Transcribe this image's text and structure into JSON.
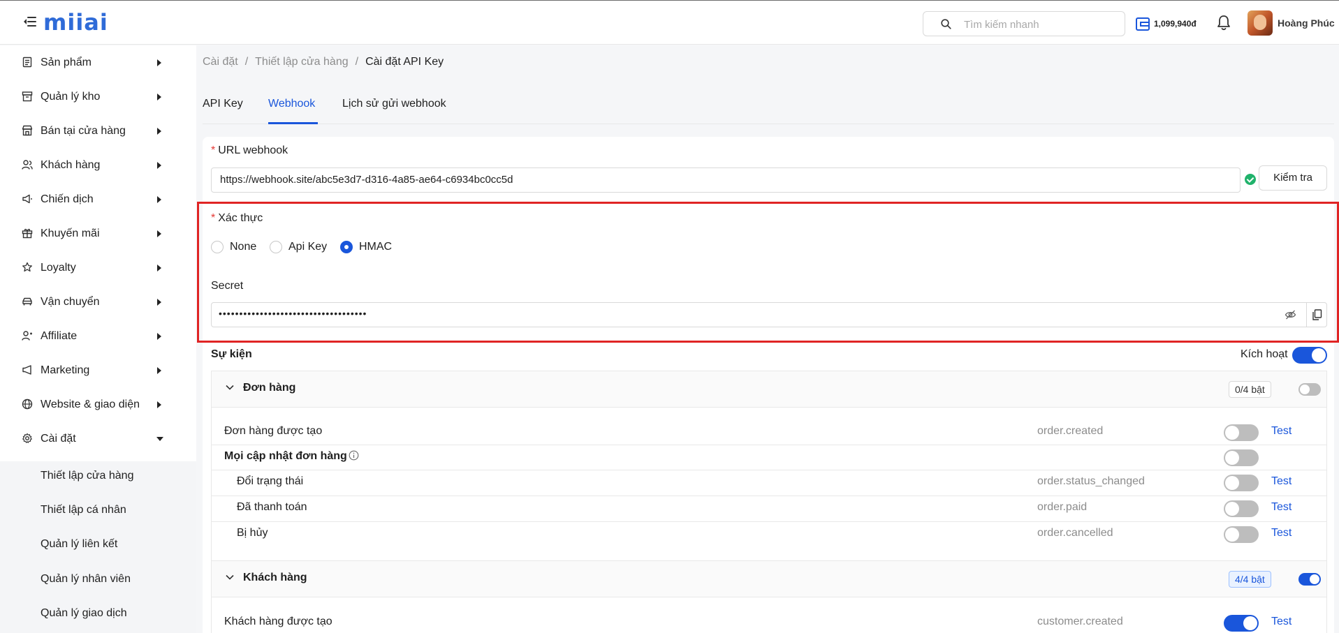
{
  "header": {
    "logo_text": "miiai",
    "search_placeholder": "Tìm kiếm nhanh",
    "wallet_balance": "1,099,940đ",
    "user_name": "Hoàng Phúc",
    "icons": [
      "menu-icon",
      "search-icon",
      "wallet-icon",
      "bell-icon"
    ]
  },
  "sidebar": {
    "items": [
      {
        "label": "Sản phẩm",
        "icon": "box-icon"
      },
      {
        "label": "Quản lý kho",
        "icon": "archive-icon"
      },
      {
        "label": "Bán tại cửa hàng",
        "icon": "store-icon"
      },
      {
        "label": "Khách hàng",
        "icon": "users-icon"
      },
      {
        "label": "Chiến dịch",
        "icon": "megaphone-icon"
      },
      {
        "label": "Khuyến mãi",
        "icon": "gift-icon"
      },
      {
        "label": "Loyalty",
        "icon": "star-icon"
      },
      {
        "label": "Vận chuyển",
        "icon": "car-icon"
      },
      {
        "label": "Affiliate",
        "icon": "affiliate-icon"
      },
      {
        "label": "Marketing",
        "icon": "marketing-icon"
      },
      {
        "label": "Website & giao diện",
        "icon": "globe-icon"
      },
      {
        "label": "Cài đặt",
        "icon": "gear-icon"
      }
    ],
    "submenu": [
      {
        "label": "Thiết lập cửa hàng"
      },
      {
        "label": "Thiết lập cá nhân"
      },
      {
        "label": "Quản lý liên kết"
      },
      {
        "label": "Quản lý nhân viên"
      },
      {
        "label": "Quản lý giao dịch"
      }
    ]
  },
  "breadcrumb": {
    "items": [
      "Cài đặt",
      "Thiết lập cửa hàng",
      "Cài đặt API Key"
    ],
    "separator": "/"
  },
  "tabs": [
    {
      "label": "API Key",
      "active": false
    },
    {
      "label": "Webhook",
      "active": true
    },
    {
      "label": "Lịch sử gửi webhook",
      "active": false
    }
  ],
  "webhook": {
    "url_label": "URL webhook",
    "url_value": "https://webhook.site/abc5e3d7-d316-4a85-ae64-c6934bc0cc5d",
    "verify_button": "Kiểm tra",
    "required_mark": "*",
    "auth": {
      "label": "Xác thực",
      "options": [
        "None",
        "Api Key",
        "HMAC"
      ],
      "selected": "HMAC"
    },
    "secret": {
      "label": "Secret",
      "masked_value": "••••••••••••••••••••••••••••••••••••"
    },
    "events": {
      "title": "Sự kiện",
      "active_label": "Kích hoạt",
      "active": true,
      "test_label": "Test",
      "groups": [
        {
          "title": "Đơn hàng",
          "count": "0/4 bật",
          "enabled": false,
          "rows": [
            {
              "name": "Đơn hàng được tạo",
              "code": "order.created",
              "enabled": false,
              "test": true
            },
            {
              "name": "Mọi cập nhật đơn hàng",
              "code": "",
              "enabled": false,
              "test": false
            },
            {
              "name": "Đổi trạng thái",
              "code": "order.status_changed",
              "enabled": false,
              "test": true
            },
            {
              "name": "Đã thanh toán",
              "code": "order.paid",
              "enabled": false,
              "test": true
            },
            {
              "name": "Bị hủy",
              "code": "order.cancelled",
              "enabled": false,
              "test": true
            }
          ]
        },
        {
          "title": "Khách hàng",
          "count": "4/4 bật",
          "enabled": true,
          "rows": [
            {
              "name": "Khách hàng được tạo",
              "code": "customer.created",
              "enabled": true,
              "test": true
            }
          ]
        }
      ]
    }
  },
  "colors": {
    "accent": "#1a56db",
    "highlight_border": "#e02424",
    "required": "#e53935",
    "success": "#20b26b"
  }
}
